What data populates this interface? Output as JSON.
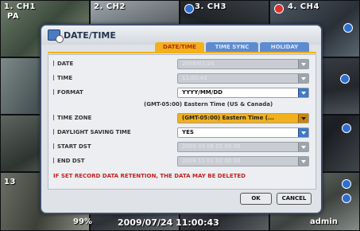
{
  "cameras": [
    {
      "label": "1. CH1",
      "sub": "PA"
    },
    {
      "label": "2. CH2",
      "sub": ""
    },
    {
      "label": "3. CH3",
      "sub": ""
    },
    {
      "label": "4. CH4",
      "sub": ""
    },
    {
      "label": "13",
      "sub": ""
    }
  ],
  "status": {
    "percent": "99%",
    "datetime": "2009/07/24 11:00:43",
    "user": "admin"
  },
  "dialog": {
    "title": "DATE/TIME",
    "tabs": [
      "DATE/TIME",
      "TIME SYNC",
      "HOLIDAY"
    ],
    "rows": [
      {
        "label": "DATE",
        "value": "2009/07/24"
      },
      {
        "label": "TIME",
        "value": "11:00:43"
      },
      {
        "label": "FORMAT",
        "value": "YYYY/MM/DD"
      },
      {
        "label": "TIME ZONE",
        "value": "(GMT-05:00) Eastern Time (..."
      },
      {
        "label": "DAYLIGHT SAVING TIME",
        "value": "YES"
      },
      {
        "label": "START DST",
        "value": "2009 03 08 02 00 00"
      },
      {
        "label": "END DST",
        "value": "2009 11 01 02 00 00"
      }
    ],
    "timezone_note": "(GMT-05:00) Eastern Time (US & Canada)",
    "warning": "IF SET RECORD DATA RETENTION,  THE DATA MAY BE DELETED",
    "ok_label": "OK",
    "cancel_label": "CANCEL"
  },
  "colors": {
    "active_tab": "#f2b01a",
    "inactive_tab": "#5d8bd0",
    "warning_text": "#c62121",
    "dialog_border": "#3d4f6b"
  }
}
